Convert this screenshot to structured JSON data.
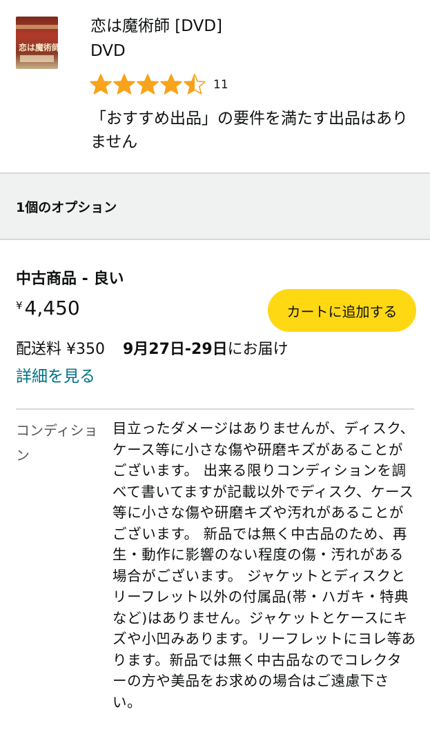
{
  "product": {
    "cover_title": "恋は魔術師",
    "title": "恋は魔術師 [DVD]",
    "format": "DVD",
    "rating": 4.5,
    "rating_count": "11",
    "notice": "「おすすめ出品」の要件を満たす出品はありません"
  },
  "options": {
    "label": "1個のオプション"
  },
  "offer": {
    "condition": "中古商品 - 良い",
    "currency": "¥",
    "price": "4,450",
    "add_to_cart": "カートに追加する",
    "shipping_fee": "配送料 ¥350",
    "delivery_date": "9月27日-29日",
    "delivery_suffix": "にお届け",
    "details_link": "詳細を見る"
  },
  "condition_note": {
    "label": "コンディション",
    "text": "目立ったダメージはありませんが、ディスク、ケース等に小さな傷や研磨キズがあることがございます。 出来る限りコンディションを調べて書いてますが記載以外でディスク、ケース等に小さな傷や研磨キズや汚れがあることがございます。 新品では無く中古品のため、再生・動作に影響のない程度の傷・汚れがある場合がございます。 ジャケットとディスクとリーフレット以外の付属品(帯・ハガキ・特典など)はありません。ジャケットとケースにキズや小凹みあります。リーフレットにヨレ等あります。新品では無く中古品なのでコレクターの方や美品をお求めの場合はご遠慮下さい。"
  },
  "colors": {
    "star": "#f7a31c",
    "button": "#ffd814",
    "link": "#007185"
  }
}
